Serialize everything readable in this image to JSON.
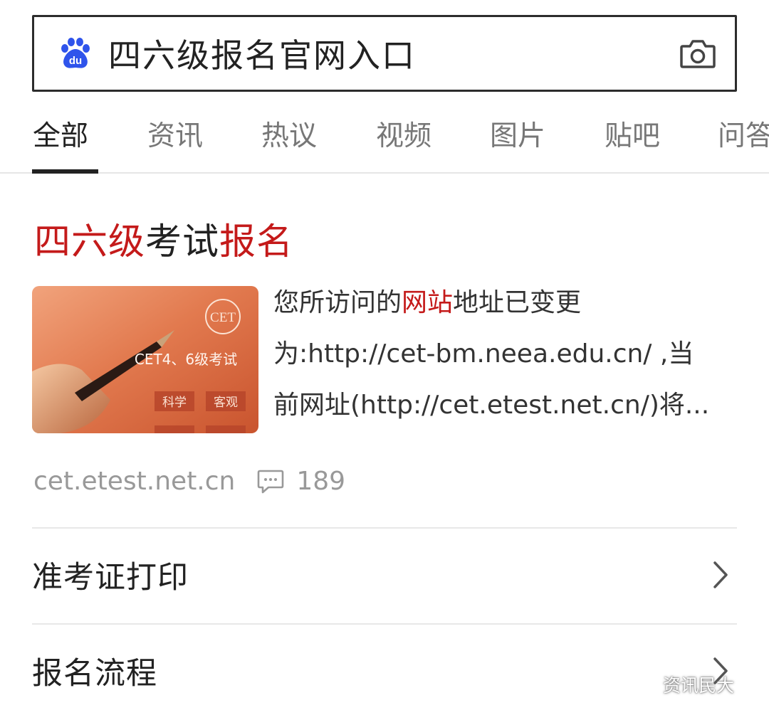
{
  "search": {
    "query": "四六级报名官网入口",
    "logo_icon": "baidu-paw-icon",
    "logo_text": "du",
    "camera_icon": "camera-icon"
  },
  "tabs": [
    {
      "label": "全部",
      "active": true
    },
    {
      "label": "资讯"
    },
    {
      "label": "热议"
    },
    {
      "label": "视频"
    },
    {
      "label": "图片"
    },
    {
      "label": "贴吧"
    },
    {
      "label": "问答"
    }
  ],
  "result": {
    "title_parts": [
      "四六级",
      "考试",
      "报名"
    ],
    "thumbnail": {
      "seal_text": "CET",
      "caption": "CET4、6级考试",
      "tags": [
        "科学",
        "客观"
      ]
    },
    "snippet": {
      "line1_parts": [
        "您所访问的",
        "网站",
        "地址已变更"
      ],
      "line2": "为:http://cet-bm.neea.edu.cn/ ,当",
      "line3": "前网址(http://cet.etest.net.cn/)将..."
    },
    "source": "cet.etest.net.cn",
    "comment_icon": "comment-bubble-icon",
    "comment_count": "189"
  },
  "links": [
    {
      "label": "准考证打印",
      "icon": "chevron-right-icon"
    },
    {
      "label": "报名流程",
      "icon": "chevron-right-icon"
    }
  ],
  "watermark": {
    "icon": "wechat-icon",
    "text": "资讯民大"
  },
  "colors": {
    "highlight": "#c41a1a",
    "baidu_blue": "#2f54eb",
    "muted": "#999999",
    "thumb_orange": "#e0734a"
  }
}
